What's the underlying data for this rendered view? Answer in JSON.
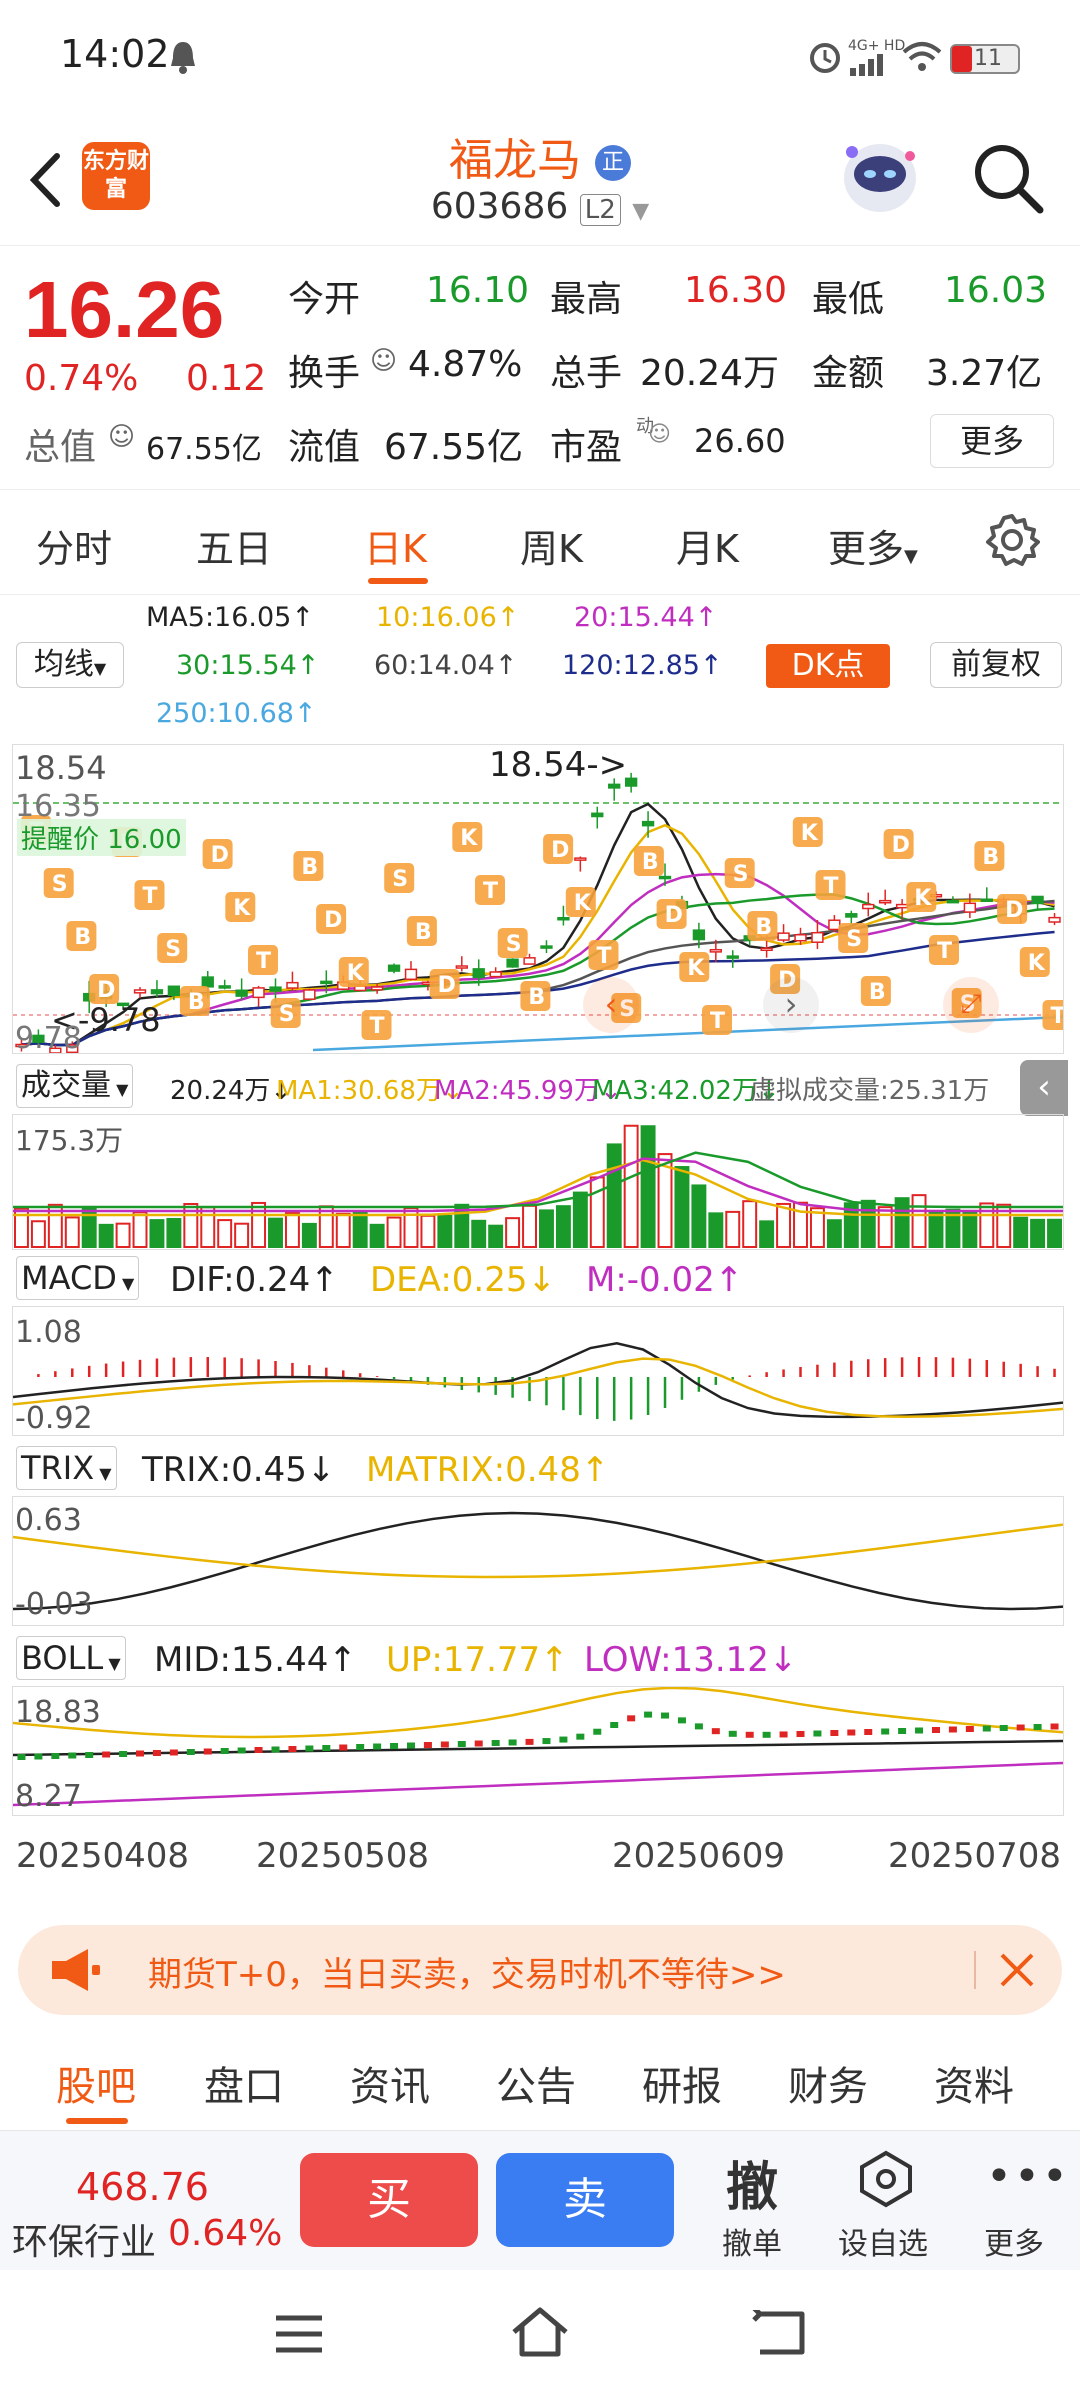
{
  "status_bar": {
    "time": "14:02",
    "network": "4G+ HD",
    "battery": "11"
  },
  "header": {
    "app_logo_text": "东方财富",
    "stock_name": "福龙马",
    "badge": "正",
    "stock_code": "603686",
    "level": "L2"
  },
  "quote": {
    "price": "16.26",
    "change_pct": "0.74%",
    "change_amt": "0.12",
    "open_label": "今开",
    "open": "16.10",
    "high_label": "最高",
    "high": "16.30",
    "low_label": "最低",
    "low": "16.03",
    "turnover_label": "换手",
    "turnover": "4.87%",
    "volume_label": "总手",
    "volume": "20.24万",
    "amount_label": "金额",
    "amount": "3.27亿",
    "total_value_label": "总值",
    "total_value": "67.55亿",
    "float_value_label": "流值",
    "float_value": "67.55亿",
    "pe_label": "市盈",
    "pe_sup": "动",
    "pe": "26.60",
    "more_label": "更多"
  },
  "chart_tabs": [
    "分时",
    "五日",
    "日K",
    "周K",
    "月K",
    "更多"
  ],
  "active_tab": "日K",
  "ma_legend": {
    "selector": "均线",
    "ma5": "MA5:16.05↑",
    "ma10": "10:16.06↑",
    "ma20": "20:15.44↑",
    "ma30": "30:15.54↑",
    "ma60": "60:14.04↑",
    "ma120": "120:12.85↑",
    "ma250": "250:10.68↑",
    "dk_button": "DK点",
    "adjust_button": "前复权"
  },
  "kline": {
    "high_label": "18.54",
    "high_annot": "18.54->",
    "alert_price": "16.35",
    "alert_label": "提醒价 16.00",
    "low_label": "9.78",
    "low_annot": "<-9.78",
    "bottom_label": "9.78",
    "signal_letters": [
      "T",
      "S",
      "B",
      "D",
      "K"
    ]
  },
  "volume": {
    "selector": "成交量",
    "vol": "20.24万↓",
    "ma1": "MA1:30.68万↓",
    "ma2": "MA2:45.99万↓",
    "ma3": "MA3:42.02万↓",
    "virtual": "虚拟成交量:25.31万",
    "axis_top": "175.3万"
  },
  "macd": {
    "selector": "MACD",
    "dif": "DIF:0.24↑",
    "dea": "DEA:0.25↓",
    "m": "M:-0.02↑",
    "axis_top": "1.08",
    "axis_bottom": "-0.92"
  },
  "trix": {
    "selector": "TRIX",
    "trix": "TRIX:0.45↓",
    "matrix": "MATRIX:0.48↑",
    "axis_top": "0.63",
    "axis_bottom": "-0.03"
  },
  "boll": {
    "selector": "BOLL",
    "mid": "MID:15.44↑",
    "up": "UP:17.77↑",
    "low": "LOW:13.12↓",
    "axis_top": "18.83",
    "axis_bottom": "8.27"
  },
  "dates": [
    "20250408",
    "20250508",
    "20250609",
    "20250708"
  ],
  "ad": {
    "text": "期货T+0，当日买卖，交易时机不等待>>"
  },
  "bottom_tabs": [
    "股吧",
    "盘口",
    "资讯",
    "公告",
    "研报",
    "财务",
    "资料"
  ],
  "action_bar": {
    "index_value": "468.76",
    "index_name": "环保行业",
    "index_change": "0.64%",
    "buy": "买",
    "sell": "卖",
    "cancel_big": "撤",
    "cancel_label": "撤单",
    "watch_label": "设自选",
    "more_label": "更多"
  },
  "colors": {
    "accent": "#f05a14",
    "up": "#e02424",
    "down": "#1a9a2a"
  }
}
